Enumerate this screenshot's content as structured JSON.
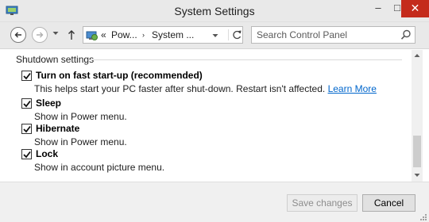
{
  "window": {
    "title": "System Settings",
    "minimize_glyph": "–",
    "maximize_glyph": "□",
    "close_glyph": "✕"
  },
  "nav": {
    "overflow": "«",
    "crumbs": [
      "Pow...",
      "System ..."
    ],
    "crumb_separator": "›",
    "search_placeholder": "Search Control Panel"
  },
  "content": {
    "section_title": "Shutdown settings",
    "options": [
      {
        "label": "Turn on fast start-up (recommended)",
        "checked": true,
        "description": "This helps start your PC faster after shut-down. Restart isn't affected.",
        "link": "Learn More"
      },
      {
        "label": "Sleep",
        "checked": true,
        "description": "Show in Power menu."
      },
      {
        "label": "Hibernate",
        "checked": true,
        "description": "Show in Power menu."
      },
      {
        "label": "Lock",
        "checked": true,
        "description": "Show in account picture menu."
      }
    ]
  },
  "footer": {
    "save_label": "Save changes",
    "save_enabled": false,
    "cancel_label": "Cancel"
  },
  "colors": {
    "close_button": "#c42b1c",
    "link": "#0066cc",
    "chrome": "#e9e9e9"
  },
  "icons": [
    "app-icon",
    "back-arrow-icon",
    "forward-arrow-icon",
    "recent-pages-icon",
    "up-arrow-icon",
    "control-panel-icon",
    "chevron-down-icon",
    "refresh-icon",
    "search-icon",
    "checkmark-icon",
    "scroll-up-icon",
    "scroll-down-icon",
    "resize-grip-icon"
  ]
}
